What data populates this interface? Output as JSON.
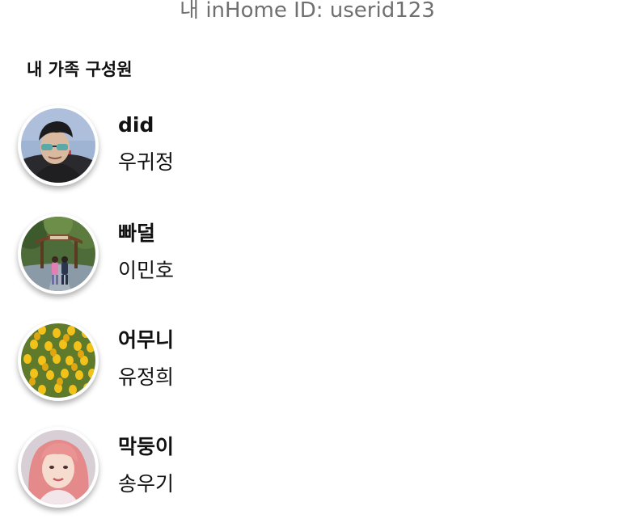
{
  "header": {
    "user_id_text": "내 inHome ID: userid123"
  },
  "family": {
    "title": "내 가족 구성원",
    "members": [
      {
        "nickname": "did",
        "name": "우귀정",
        "avatar_icon": "man-sunglasses-photo"
      },
      {
        "nickname": "빠덜",
        "name": "이민호",
        "avatar_icon": "park-gate-photo"
      },
      {
        "nickname": "어무니",
        "name": "유정희",
        "avatar_icon": "tulip-field-photo"
      },
      {
        "nickname": "막둥이",
        "name": "송우기",
        "avatar_icon": "pink-hair-woman-photo"
      }
    ]
  }
}
